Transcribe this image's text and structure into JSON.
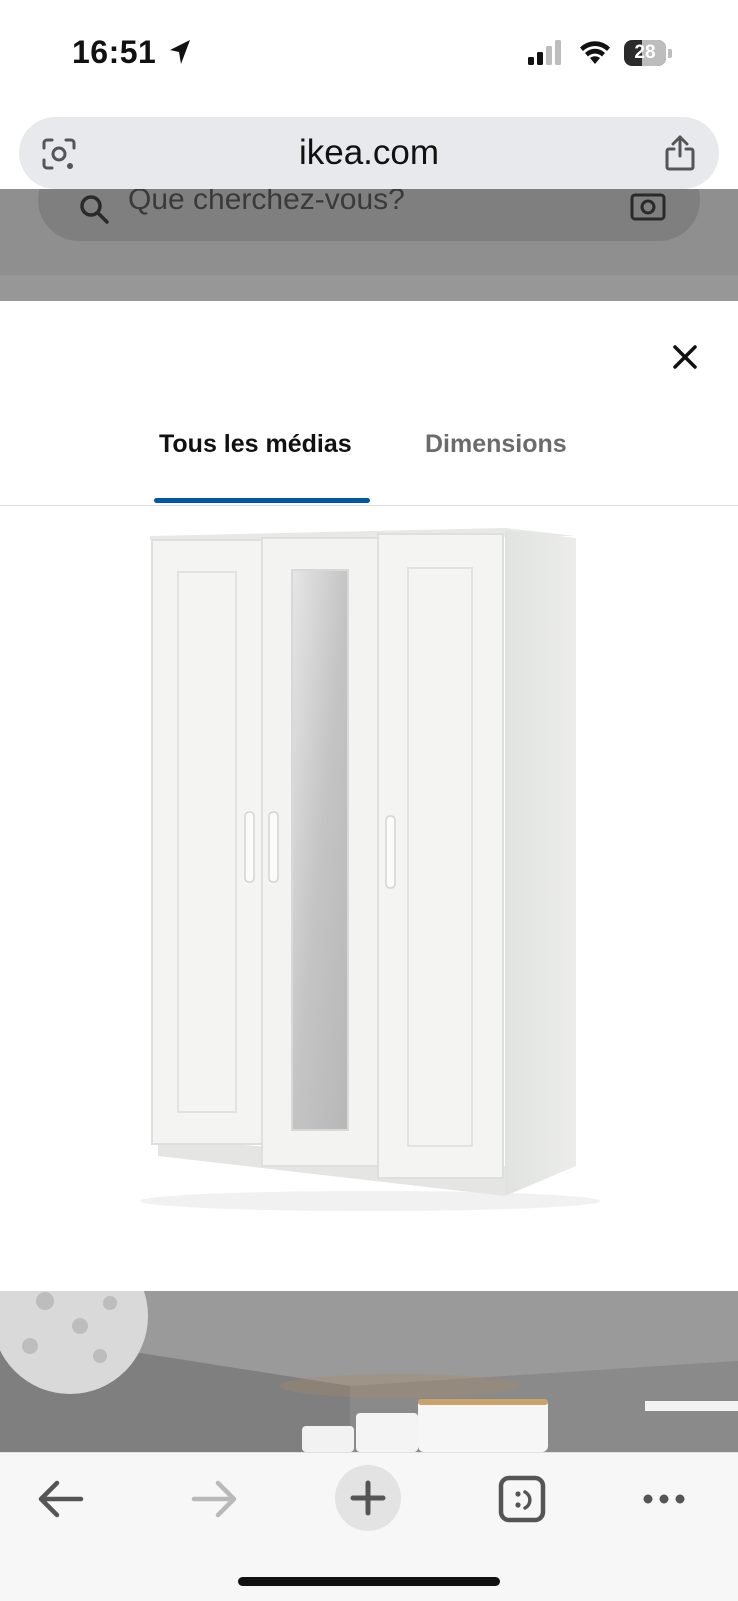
{
  "status_bar": {
    "time": "16:51",
    "battery_level": "28",
    "icons": [
      "location-arrow-icon",
      "cellular-signal-icon",
      "wifi-icon",
      "battery-icon"
    ]
  },
  "browser": {
    "url": "ikea.com",
    "icons": [
      "visual-search-icon",
      "share-icon"
    ]
  },
  "background_page": {
    "search_placeholder": "Que cherchez-vous?"
  },
  "media_modal": {
    "tabs": [
      {
        "label": "Tous les médias",
        "active": true
      },
      {
        "label": "Dimensions",
        "active": false
      }
    ],
    "accent_color": "#0058a3",
    "images": [
      "white-three-door-wardrobe-with-mirror",
      "bedroom-room-scene"
    ]
  },
  "toolbar": {
    "buttons": [
      "back-arrow-icon",
      "forward-arrow-icon",
      "new-tab-plus-icon",
      "tabs-overview-icon",
      "more-options-icon"
    ],
    "forward_enabled": false
  }
}
